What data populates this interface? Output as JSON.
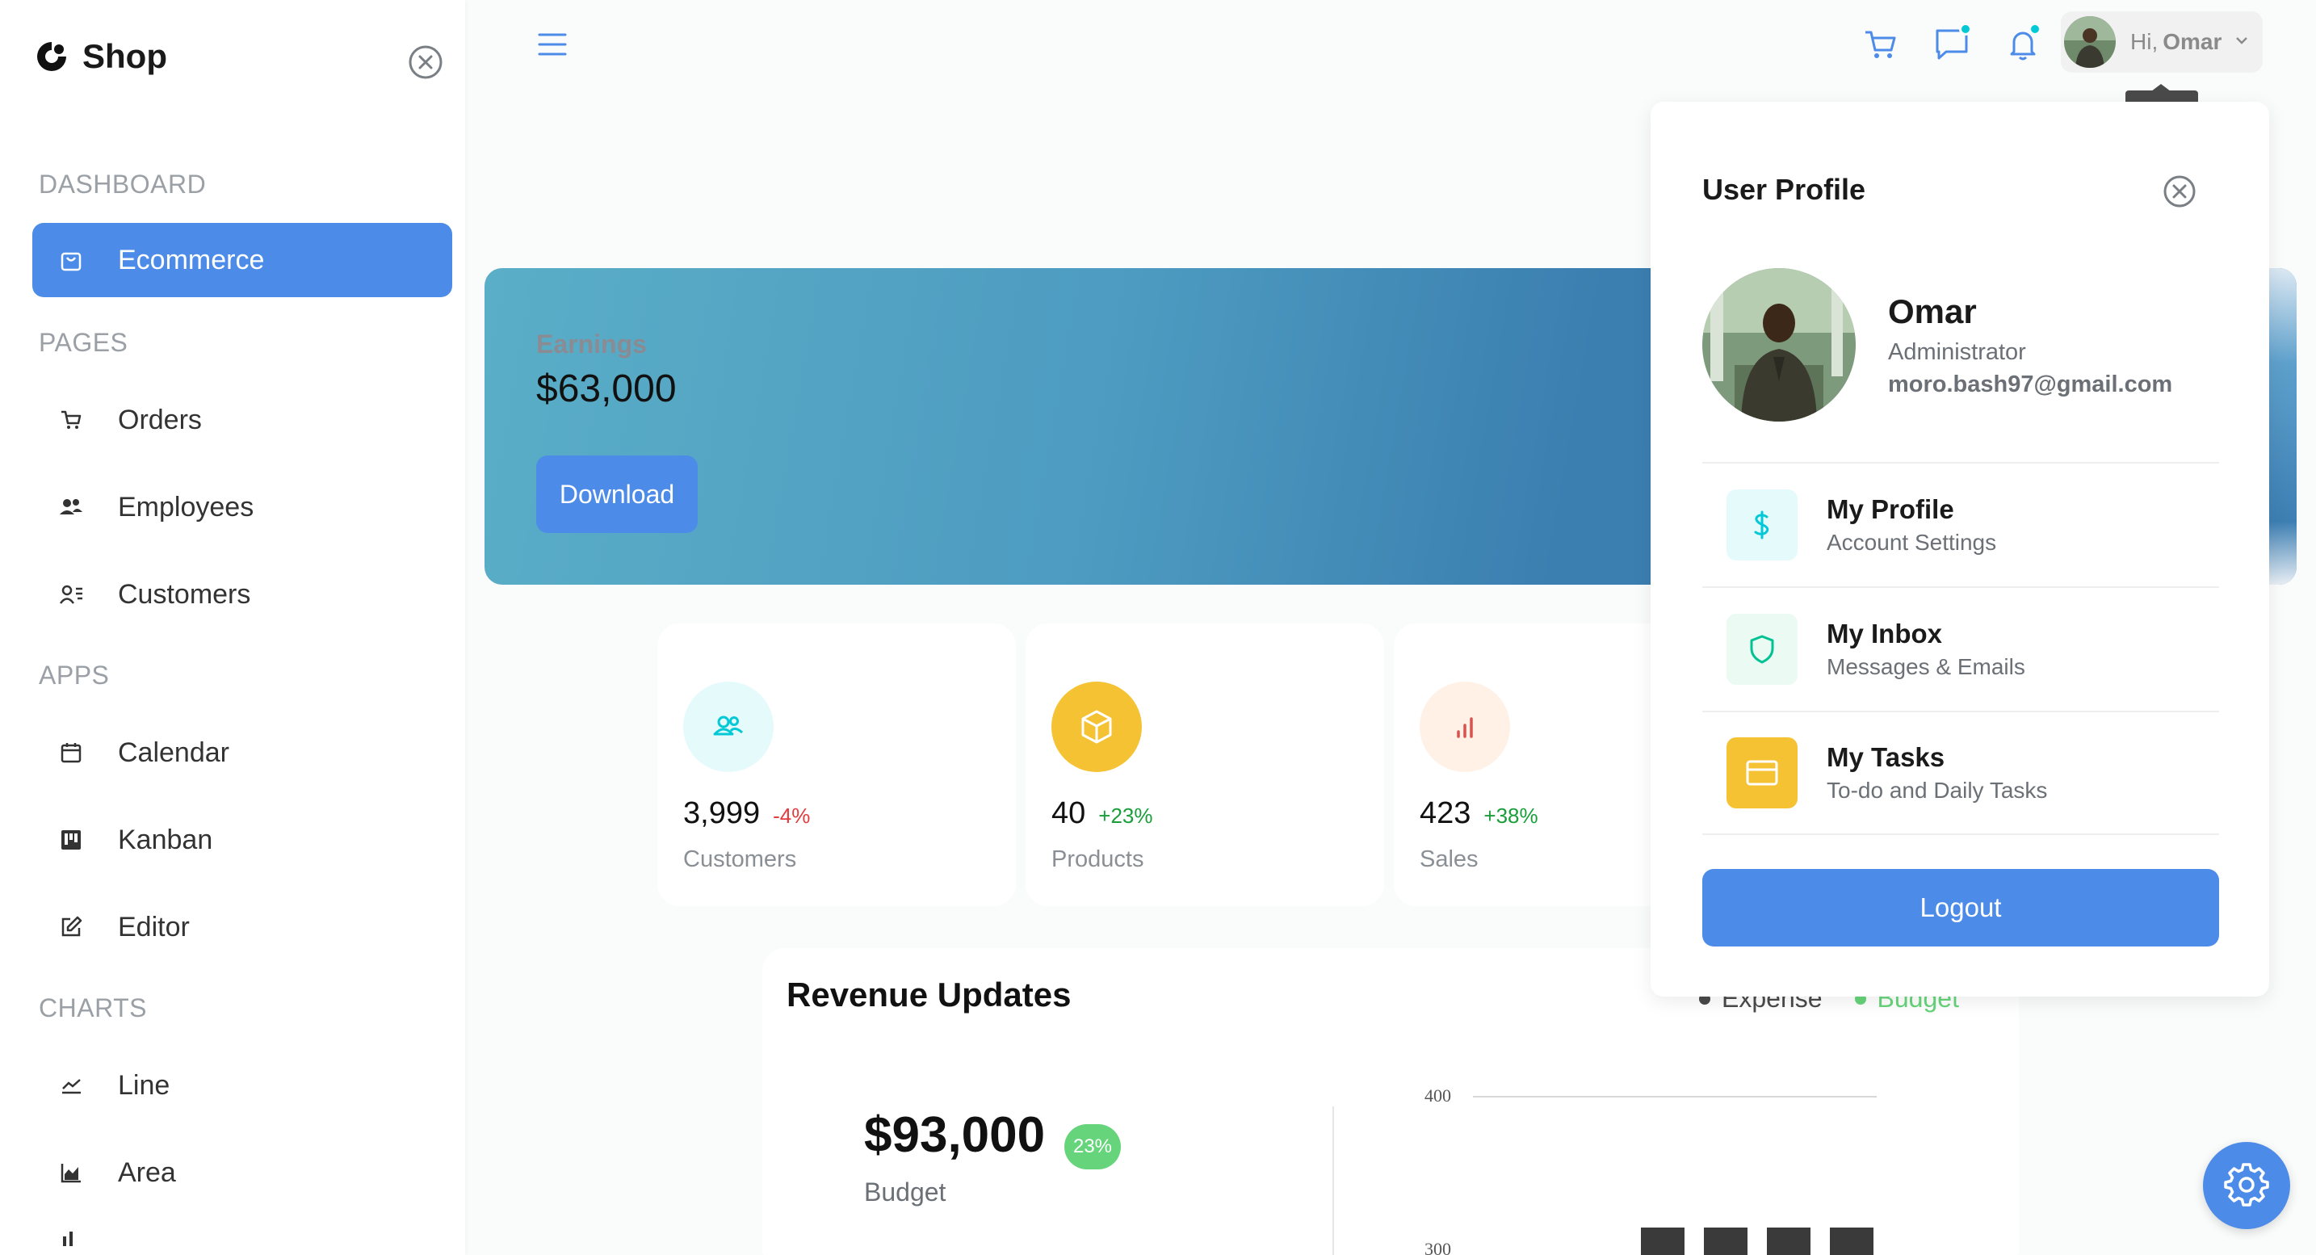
{
  "app": {
    "brand": "Shop"
  },
  "sidebar": {
    "sections": {
      "dashboard": "DASHBOARD",
      "pages": "PAGES",
      "apps": "APPS",
      "charts": "CHARTS"
    },
    "items": {
      "ecommerce": "Ecommerce",
      "orders": "Orders",
      "employees": "Employees",
      "customers": "Customers",
      "calendar": "Calendar",
      "kanban": "Kanban",
      "editor": "Editor",
      "line": "Line",
      "area": "Area"
    },
    "active_item": "Ecommerce"
  },
  "topbar": {
    "greeting": "Hi,",
    "username": "Omar"
  },
  "earnings": {
    "label": "Earnings",
    "value": "$63,000",
    "button": "Download"
  },
  "stats": [
    {
      "value": "3,999",
      "change": "-4%",
      "change_color": "#e23c3c",
      "label": "Customers",
      "icon": "customers-icon",
      "icon_bg": "#e5fafb",
      "icon_color": "#03c9d7"
    },
    {
      "value": "40",
      "change": "+23%",
      "change_color": "#1a9e3a",
      "label": "Products",
      "icon": "box-icon",
      "icon_bg": "#f4c232",
      "icon_color": "#ffffff"
    },
    {
      "value": "423",
      "change": "+38%",
      "change_color": "#1a9e3a",
      "label": "Sales",
      "icon": "bar-chart-icon",
      "icon_bg": "#fff1e6",
      "icon_color": "#d9534f"
    }
  ],
  "revenue": {
    "title": "Revenue Updates",
    "legend_expense": "Expense",
    "legend_budget": "Budget",
    "budget_value": "$93,000",
    "budget_badge": "23%",
    "budget_label": "Budget",
    "chart_ticks": [
      "400",
      "300"
    ]
  },
  "profile": {
    "title": "User Profile",
    "name": "Omar",
    "role": "Administrator",
    "email": "moro.bash97@gmail.com",
    "items": [
      {
        "title": "My Profile",
        "desc": "Account Settings",
        "icon": "dollar-icon",
        "bg": "#e5fafb",
        "color": "#03c9d7"
      },
      {
        "title": "My Inbox",
        "desc": "Messages & Emails",
        "icon": "shield-icon",
        "bg": "#ebfaf2",
        "color": "#00c292"
      },
      {
        "title": "My Tasks",
        "desc": "To-do and Daily Tasks",
        "icon": "card-icon",
        "bg": "#f4c232",
        "color": "#ffffff"
      }
    ],
    "logout": "Logout"
  },
  "colors": {
    "accent": "#4c8ce8",
    "sidebar_bg": "#ffffff",
    "page_bg": "#fafbfb"
  }
}
